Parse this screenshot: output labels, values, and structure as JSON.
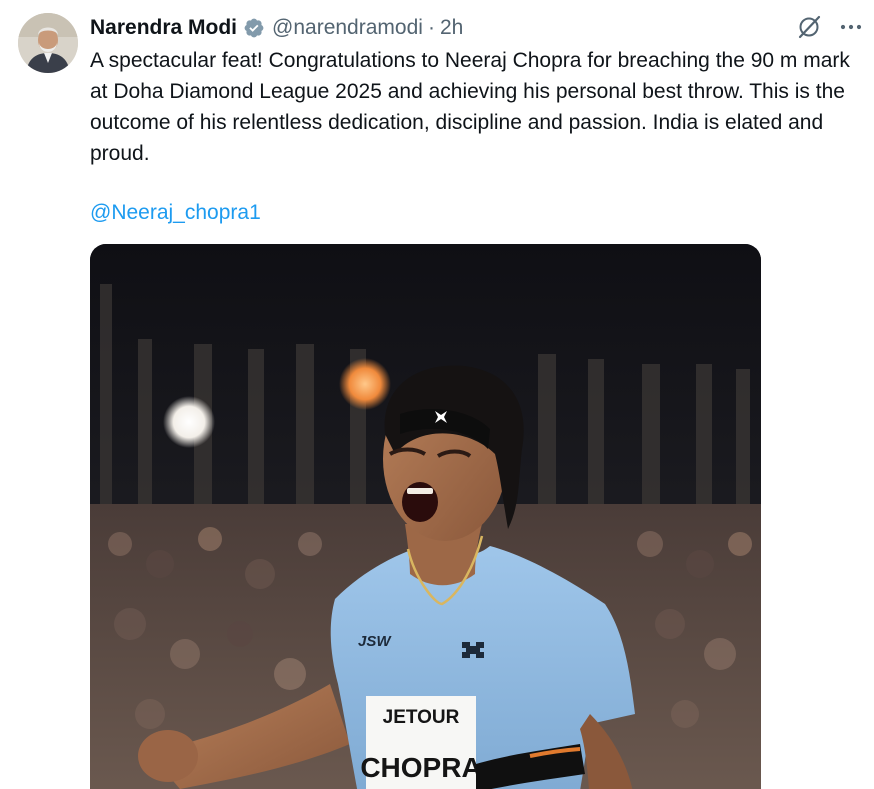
{
  "author": {
    "name": "Narendra Modi",
    "handle": "@narendramodi",
    "separator": "·",
    "time": "2h",
    "verified": true,
    "avatar_icon": "profile-photo"
  },
  "actions": {
    "grok_icon": "grok-icon",
    "more_icon": "more-options-icon"
  },
  "tweet": {
    "text": "A spectacular feat! Congratulations to Neeraj Chopra for breaching the 90 m mark at Doha Diamond League 2025 and achieving his personal best throw. This is the outcome of his relentless dedication, discipline and passion. India is elated and proud.",
    "mention": "@Neeraj_chopra1"
  },
  "media": {
    "bib_top": "JETOUR",
    "bib_name": "CHOPRA",
    "shirt_logo": "JSW"
  },
  "colors": {
    "link": "#1d9bf0",
    "verified": "#829aab",
    "secondary_text": "#536471",
    "shirt": "#8fb9df"
  }
}
